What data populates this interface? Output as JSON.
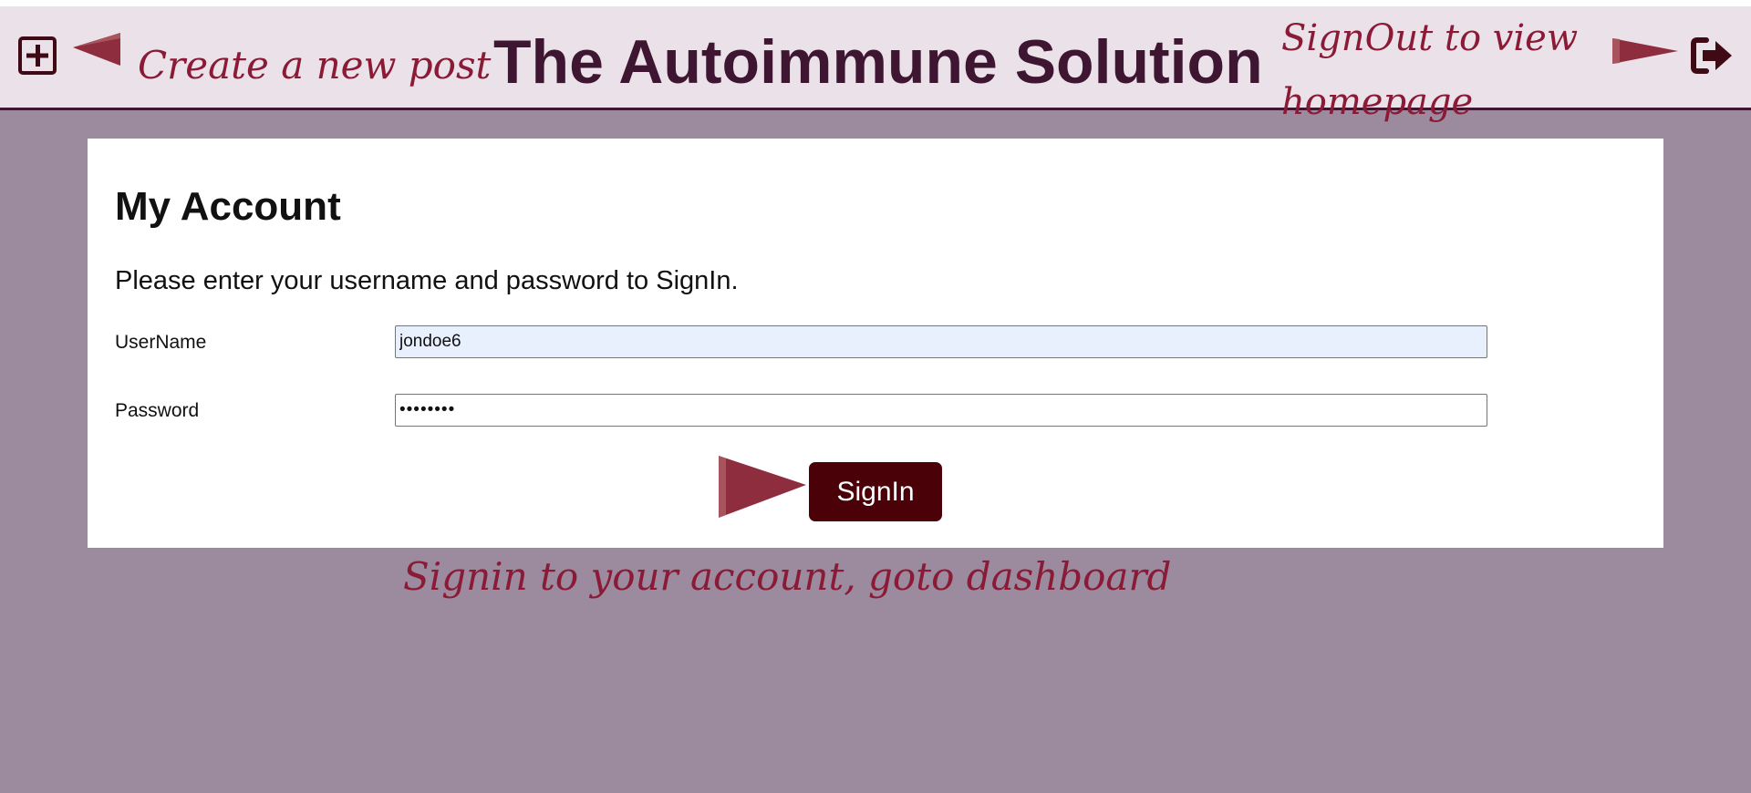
{
  "header": {
    "create_post_note": "Create a new post",
    "site_title": "The Autoimmune Solution",
    "signout_note": "SignOut to view homepage",
    "add_icon": "plus-square-icon",
    "signout_icon": "sign-out-icon"
  },
  "account": {
    "title": "My Account",
    "intro": "Please enter your username and password to SignIn.",
    "username_label": "UserName",
    "username_value": "jondoe6",
    "password_label": "Password",
    "password_value": "********",
    "signin_label": "SignIn"
  },
  "notes": {
    "signin_note": "Signin to your account, goto dashboard"
  },
  "colors": {
    "page_bg": "#9c8a9e",
    "header_bg": "#ebe2e9",
    "title": "#3f1632",
    "accent": "#8a1a36",
    "button": "#4a0208"
  }
}
